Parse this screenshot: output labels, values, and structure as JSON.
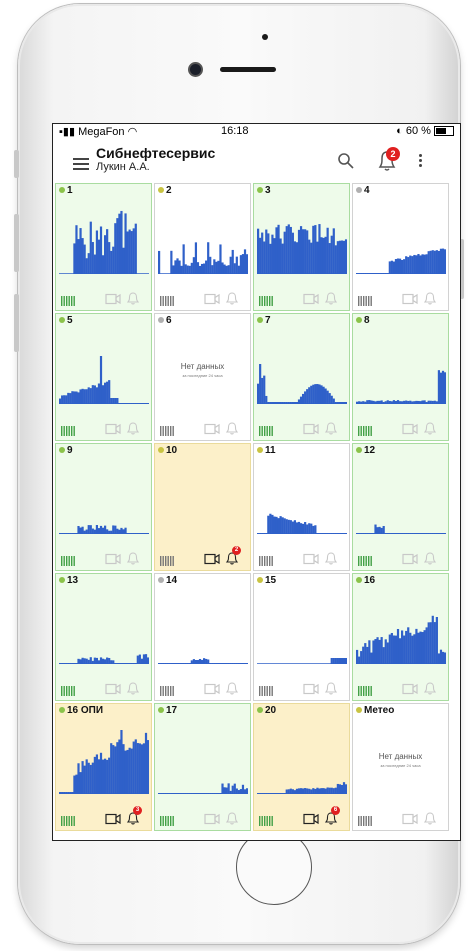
{
  "status_bar": {
    "carrier": "MegaFon",
    "time": "16:18",
    "battery": "60 %"
  },
  "header": {
    "company": "Сибнефтесервис",
    "user": "Лукин А.А.",
    "notifications_count": "2"
  },
  "colors": {
    "green": "#8bc34a",
    "yellow": "#c9c443",
    "gray": "#b0b0b0",
    "chart": "#2f60c9",
    "alert": "#e02020"
  },
  "tiles": [
    {
      "label": "1",
      "status": "green",
      "bg": "green",
      "chart": "c1",
      "alert": ""
    },
    {
      "label": "2",
      "status": "yellow",
      "bg": "white",
      "chart": "c2",
      "alert": ""
    },
    {
      "label": "3",
      "status": "green",
      "bg": "green",
      "chart": "c3",
      "alert": ""
    },
    {
      "label": "4",
      "status": "gray",
      "bg": "white",
      "chart": "c4",
      "alert": ""
    },
    {
      "label": "5",
      "status": "green",
      "bg": "green",
      "chart": "c5",
      "alert": ""
    },
    {
      "label": "6",
      "status": "gray",
      "bg": "white",
      "chart": "none",
      "alert": ""
    },
    {
      "label": "7",
      "status": "green",
      "bg": "green",
      "chart": "c7",
      "alert": ""
    },
    {
      "label": "8",
      "status": "green",
      "bg": "green",
      "chart": "c8",
      "alert": ""
    },
    {
      "label": "9",
      "status": "green",
      "bg": "green",
      "chart": "c9",
      "alert": ""
    },
    {
      "label": "10",
      "status": "yellow",
      "bg": "yellow",
      "chart": "none_blank",
      "alert": "2"
    },
    {
      "label": "11",
      "status": "yellow",
      "bg": "white",
      "chart": "c11",
      "alert": ""
    },
    {
      "label": "12",
      "status": "green",
      "bg": "green",
      "chart": "c12",
      "alert": ""
    },
    {
      "label": "13",
      "status": "green",
      "bg": "green",
      "chart": "c13",
      "alert": ""
    },
    {
      "label": "14",
      "status": "gray",
      "bg": "white",
      "chart": "c14",
      "alert": ""
    },
    {
      "label": "15",
      "status": "yellow",
      "bg": "white",
      "chart": "c15",
      "alert": ""
    },
    {
      "label": "16",
      "status": "green",
      "bg": "green",
      "chart": "c16",
      "alert": ""
    },
    {
      "label": "16 ОПИ",
      "status": "green",
      "bg": "yellow",
      "chart": "c17",
      "alert": "3"
    },
    {
      "label": "17",
      "status": "green",
      "bg": "green",
      "chart": "c18",
      "alert": ""
    },
    {
      "label": "20",
      "status": "green",
      "bg": "yellow",
      "chart": "c20",
      "alert": "6"
    },
    {
      "label": "Метео",
      "status": "yellow",
      "bg": "white",
      "chart": "none",
      "alert": ""
    }
  ],
  "no_data": {
    "title": "Нет данных",
    "subtitle": "за последние 24 часа"
  }
}
